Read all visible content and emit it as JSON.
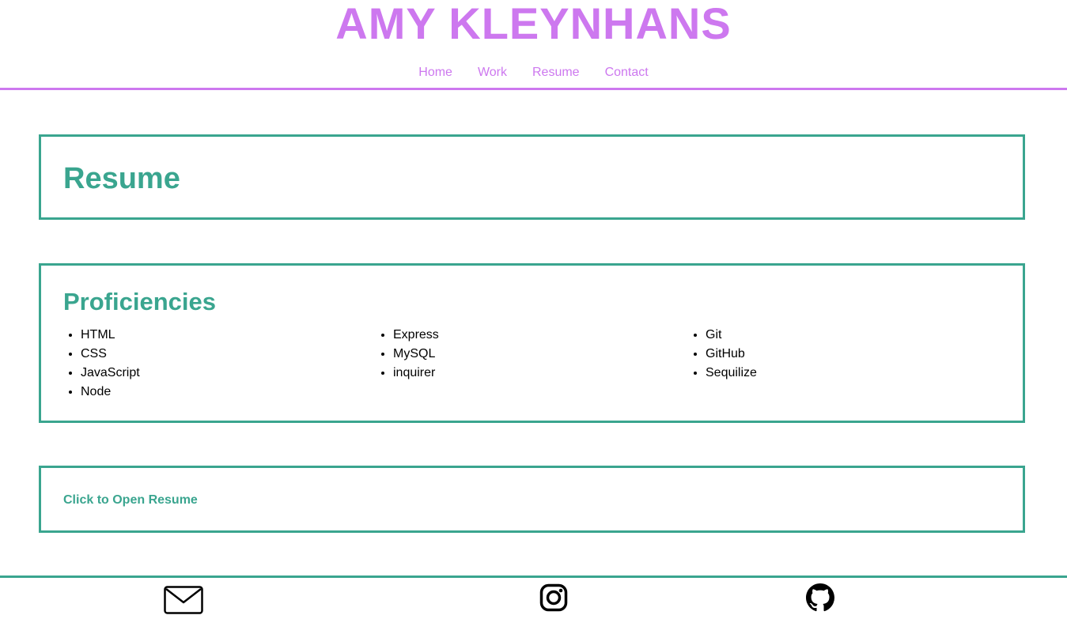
{
  "header": {
    "title": "AMY KLEYNHANS",
    "nav": [
      {
        "label": "Home"
      },
      {
        "label": "Work"
      },
      {
        "label": "Resume"
      },
      {
        "label": "Contact"
      }
    ]
  },
  "resume_section": {
    "heading": "Resume"
  },
  "proficiencies": {
    "heading": "Proficiencies",
    "columns": [
      [
        "HTML",
        "CSS",
        "JavaScript",
        "Node"
      ],
      [
        "Express",
        "MySQL",
        "inquirer"
      ],
      [
        "Git",
        "GitHub",
        "Sequilize"
      ]
    ]
  },
  "resume_link": {
    "label": "Click to Open Resume"
  },
  "footer": {
    "icons": [
      "mail-icon",
      "instagram-icon",
      "github-icon"
    ]
  },
  "colors": {
    "accent_purple": "#cd78ef",
    "accent_teal": "#3aa58f"
  }
}
